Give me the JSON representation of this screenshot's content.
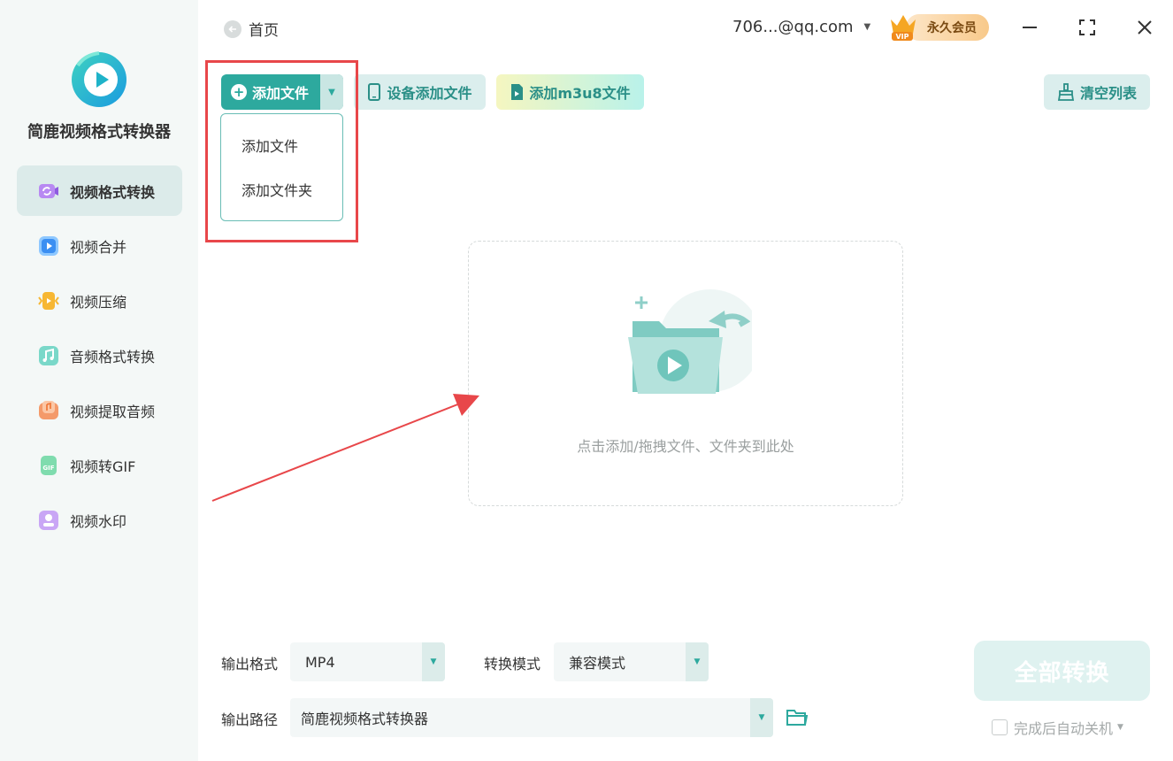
{
  "app": {
    "name": "简鹿视频格式转换器"
  },
  "sidebar": {
    "items": [
      {
        "label": "视频格式转换",
        "icon": "video-convert-icon",
        "active": true
      },
      {
        "label": "视频合并",
        "icon": "video-merge-icon",
        "active": false
      },
      {
        "label": "视频压缩",
        "icon": "video-compress-icon",
        "active": false
      },
      {
        "label": "音频格式转换",
        "icon": "audio-convert-icon",
        "active": false
      },
      {
        "label": "视频提取音频",
        "icon": "extract-audio-icon",
        "active": false
      },
      {
        "label": "视频转GIF",
        "icon": "gif-icon",
        "active": false
      },
      {
        "label": "视频水印",
        "icon": "watermark-icon",
        "active": false
      }
    ]
  },
  "header": {
    "home_label": "首页",
    "account": "706...@qq.com",
    "vip_label": "永久会员",
    "vip_badge": "VIP"
  },
  "toolbar": {
    "add_file_label": "添加文件",
    "device_add_label": "设备添加文件",
    "m3u8_label": "添加m3u8文件",
    "clear_label": "清空列表"
  },
  "add_menu": {
    "items": [
      "添加文件",
      "添加文件夹"
    ]
  },
  "dropzone": {
    "hint": "点击添加/拖拽文件、文件夹到此处"
  },
  "bottom": {
    "output_format_label": "输出格式",
    "output_format_value": "MP4",
    "convert_mode_label": "转换模式",
    "convert_mode_value": "兼容模式",
    "output_path_label": "输出路径",
    "output_path_value": "简鹿视频格式转换器",
    "convert_all_label": "全部转换",
    "auto_shutdown_label": "完成后自动关机"
  },
  "colors": {
    "accent": "#2da99e",
    "highlight": "#e8474a"
  }
}
